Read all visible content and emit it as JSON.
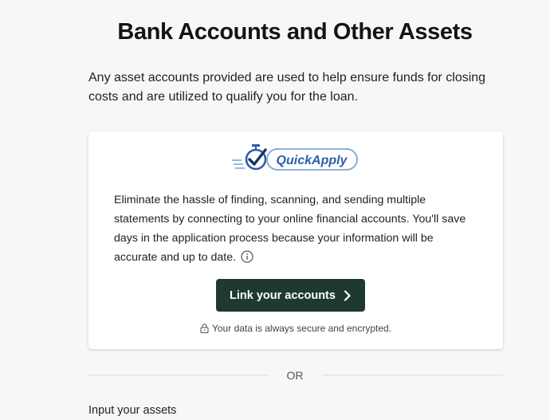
{
  "page": {
    "title": "Bank Accounts and Other Assets",
    "intro": "Any asset accounts provided are used to help ensure funds for closing costs and are utilized to qualify you for the loan."
  },
  "card": {
    "logo_text": "QuickApply",
    "body": "Eliminate the hassle of finding, scanning, and sending multiple statements by connecting to your online financial accounts. You'll save days in the application process because your information will be accurate and up to date.",
    "link_button_label": "Link your accounts",
    "secure_note": "Your data is always secure and encrypted.",
    "icons": {
      "logo": "stopwatch-check-icon",
      "info": "info-icon",
      "button": "chevron-right-icon",
      "secure": "lock-icon"
    }
  },
  "separator": {
    "label": "OR"
  },
  "section": {
    "input_assets_label": "Input your assets"
  },
  "colors": {
    "background": "#f7f7f7",
    "button": "#1e3a2e",
    "brand_blue": "#2e5fa8"
  }
}
